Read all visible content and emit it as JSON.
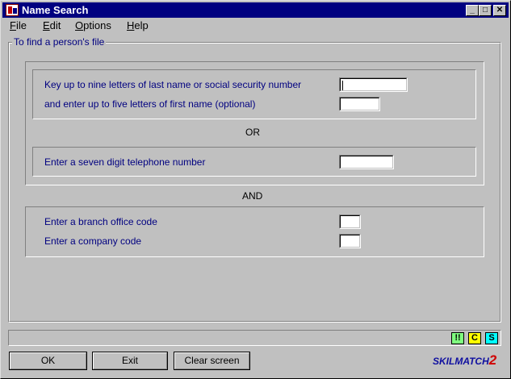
{
  "window": {
    "title": "Name Search"
  },
  "titlebar_buttons": {
    "minimize": "_",
    "maximize": "□",
    "close": "✕"
  },
  "menu": [
    {
      "first": "F",
      "rest": "ile"
    },
    {
      "first": "E",
      "rest": "dit"
    },
    {
      "first": "O",
      "rest": "ptions"
    },
    {
      "first": "H",
      "rest": "elp"
    }
  ],
  "form": {
    "group_title": "To find a person's file",
    "name_line1": "Key up to nine letters of last name or social security number",
    "name_line2": "and enter up to five letters of first name   (optional)",
    "or": "OR",
    "phone_label": "Enter a seven digit telephone number",
    "and": "AND",
    "branch_label": "Enter a branch office code",
    "company_label": "Enter a company code",
    "last_name_value": "",
    "first_name_value": "",
    "phone_value": "",
    "branch_value": "",
    "company_value": ""
  },
  "status_badges": [
    {
      "text": "!!",
      "color": "#80ff80"
    },
    {
      "text": "C",
      "color": "#ffff00"
    },
    {
      "text": "S",
      "color": "#00ffff"
    }
  ],
  "buttons": {
    "ok": "OK",
    "exit": "Exit",
    "clear": "Clear screen"
  },
  "logo": {
    "text": "SKILMATCH",
    "number": "2"
  }
}
